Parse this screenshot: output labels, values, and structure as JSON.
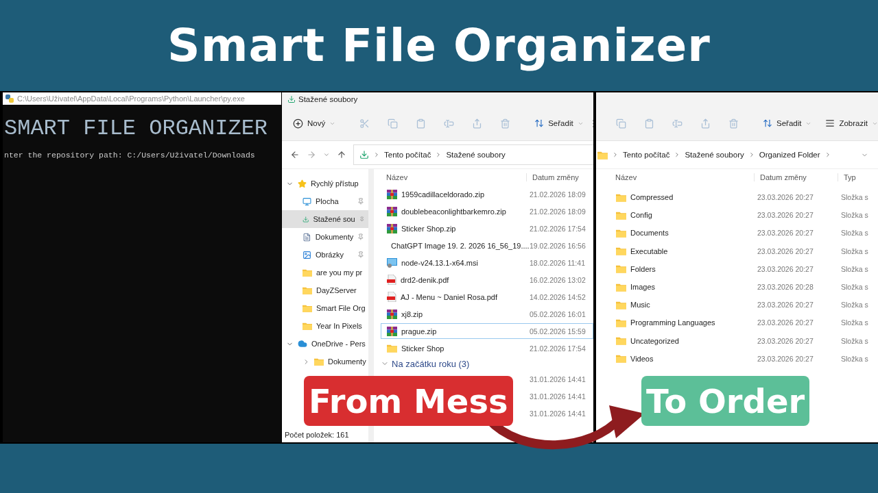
{
  "title": "Smart File Organizer",
  "console": {
    "title": "C:\\Users\\Uživatel\\AppData\\Local\\Programs\\Python\\Launcher\\py.exe",
    "banner": "SMART FILE ORGANIZER",
    "lines": [
      "nter the repository path: C:/Users/Uživatel/Downloads"
    ]
  },
  "explorer_left": {
    "title": "Stažené soubory",
    "new_button": "Nový",
    "sort_button": "Seřadit",
    "breadcrumb": [
      "Tento počítač",
      "Stažené soubory"
    ],
    "sidebar": [
      {
        "label": "Rychlý přístup",
        "kind": "star",
        "expanded": true,
        "children": [
          {
            "label": "Plocha",
            "kind": "desktop",
            "pinned": true,
            "selected": false
          },
          {
            "label": "Stažené sou",
            "kind": "download",
            "pinned": true,
            "selected": true
          },
          {
            "label": "Dokumenty",
            "kind": "docs",
            "pinned": true,
            "selected": false
          },
          {
            "label": "Obrázky",
            "kind": "pictures",
            "pinned": true,
            "selected": false
          },
          {
            "label": "are you my pr",
            "kind": "folder",
            "pinned": false,
            "selected": false
          },
          {
            "label": "DayZServer",
            "kind": "folder",
            "pinned": false,
            "selected": false
          },
          {
            "label": "Smart File Org",
            "kind": "folder",
            "pinned": false,
            "selected": false
          },
          {
            "label": "Year In Pixels",
            "kind": "folder",
            "pinned": false,
            "selected": false
          }
        ]
      },
      {
        "label": "OneDrive - Pers",
        "kind": "cloud",
        "expanded": true,
        "children": [
          {
            "label": "Dokumenty",
            "kind": "folder",
            "expanded": false,
            "selected": false
          }
        ]
      }
    ],
    "columns": [
      "Název",
      "Datum změny"
    ],
    "rows": [
      {
        "name": "1959cadillaceldorado.zip",
        "date": "21.02.2026 18:09",
        "kind": "zip",
        "selected": false
      },
      {
        "name": "doublebeaconlightbarkemro.zip",
        "date": "21.02.2026 18:09",
        "kind": "zip",
        "selected": false
      },
      {
        "name": "Sticker Shop.zip",
        "date": "21.02.2026 17:54",
        "kind": "zip",
        "selected": false
      },
      {
        "name": "ChatGPT Image 19. 2. 2026 16_56_19....",
        "date": "19.02.2026 16:56",
        "kind": "image",
        "selected": false
      },
      {
        "name": "node-v24.13.1-x64.msi",
        "date": "18.02.2026 11:41",
        "kind": "msi",
        "selected": false
      },
      {
        "name": "drd2-denik.pdf",
        "date": "16.02.2026 13:02",
        "kind": "pdf",
        "selected": false
      },
      {
        "name": "AJ - Menu ~ Daniel Rosa.pdf",
        "date": "14.02.2026 14:52",
        "kind": "pdf",
        "selected": false
      },
      {
        "name": "xj8.zip",
        "date": "05.02.2026 16:01",
        "kind": "zip",
        "selected": false
      },
      {
        "name": "prague.zip",
        "date": "05.02.2026 15:59",
        "kind": "zip",
        "selected": true
      },
      {
        "name": "Sticker Shop",
        "date": "21.02.2026 17:54",
        "kind": "folder",
        "selected": false
      }
    ],
    "group": {
      "label": "Na začátku roku (3)",
      "expanded": true,
      "rows": [
        {
          "date": "31.01.2026 14:41"
        },
        {
          "date": "31.01.2026 14:41"
        },
        {
          "date": "31.01.2026 14:41"
        }
      ]
    },
    "status": "Počet položek: 161"
  },
  "explorer_right": {
    "sort_button": "Seřadit",
    "view_button": "Zobrazit",
    "breadcrumb": [
      "Tento počítač",
      "Stažené soubory",
      "Organized Folder"
    ],
    "columns": [
      "Název",
      "Datum změny",
      "Typ"
    ],
    "rows": [
      {
        "name": "Compressed",
        "date": "23.03.2026 20:27",
        "type": "Složka s"
      },
      {
        "name": "Config",
        "date": "23.03.2026 20:27",
        "type": "Složka s"
      },
      {
        "name": "Documents",
        "date": "23.03.2026 20:27",
        "type": "Složka s"
      },
      {
        "name": "Executable",
        "date": "23.03.2026 20:27",
        "type": "Složka s"
      },
      {
        "name": "Folders",
        "date": "23.03.2026 20:27",
        "type": "Složka s"
      },
      {
        "name": "Images",
        "date": "23.03.2026 20:28",
        "type": "Složka s"
      },
      {
        "name": "Music",
        "date": "23.03.2026 20:27",
        "type": "Složka s"
      },
      {
        "name": "Programming Languages",
        "date": "23.03.2026 20:27",
        "type": "Složka s"
      },
      {
        "name": "Uncategorized",
        "date": "23.03.2026 20:27",
        "type": "Složka s"
      },
      {
        "name": "Videos",
        "date": "23.03.2026 20:27",
        "type": "Složka s"
      }
    ]
  },
  "badges": [
    {
      "text": "From Mess",
      "color": "#d82e30"
    },
    {
      "text": "To Order",
      "color": "#5cbf98"
    }
  ]
}
